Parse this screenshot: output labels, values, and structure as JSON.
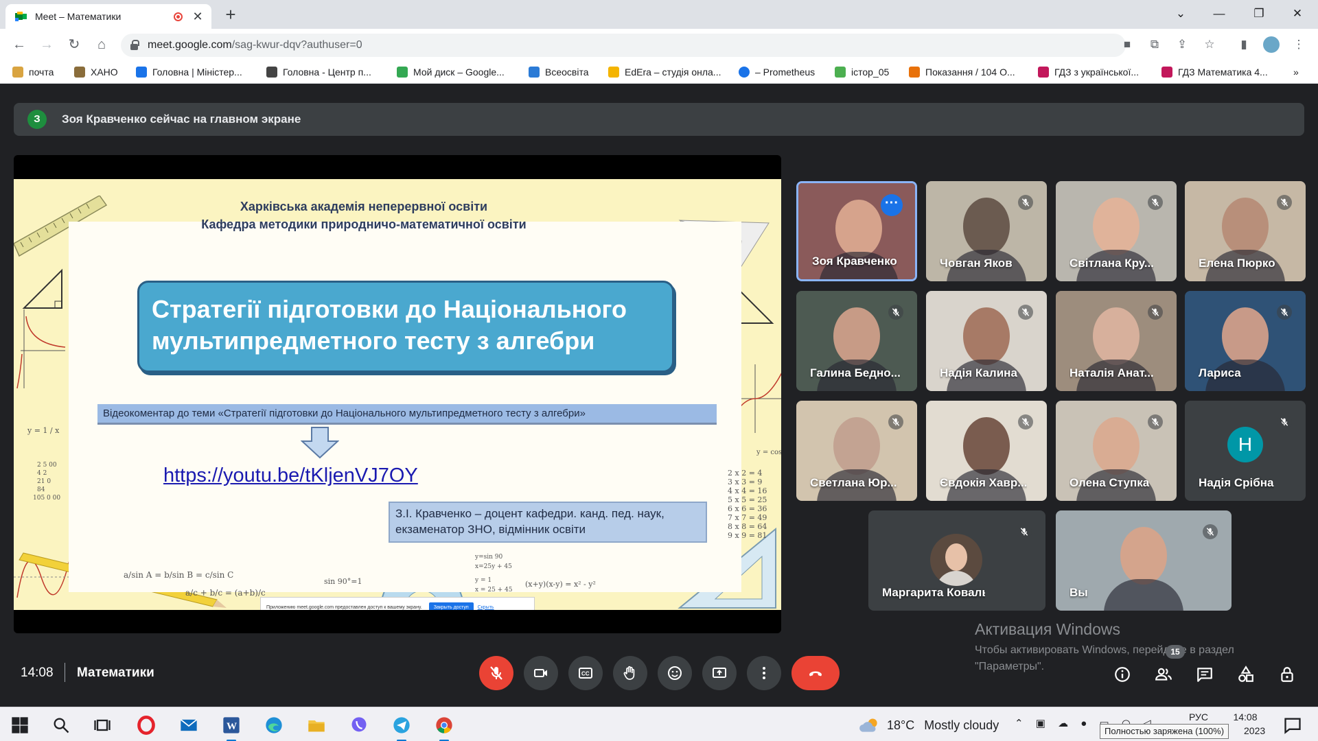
{
  "browser": {
    "tab_title": "Meet – Математики",
    "url_host": "meet.google.com",
    "url_path": "/sag-kwur-dqv?authuser=0",
    "new_tab_label": "+"
  },
  "bookmarks": [
    {
      "label": "почта",
      "icon_color": "#d9a441"
    },
    {
      "label": "ХАНО",
      "icon_color": "#8a6d3b"
    },
    {
      "label": "Головна | Міністер...",
      "icon_color": "#1a73e8"
    },
    {
      "label": "Головна - Центр п...",
      "icon_color": "#444444"
    },
    {
      "label": "Мой диск – Google...",
      "icon_color": "#34a853"
    },
    {
      "label": "Всеосвіта",
      "icon_color": "#2b7bd6"
    },
    {
      "label": "EdEra – студія онла...",
      "icon_color": "#f4b400"
    },
    {
      "label": "– Prometheus",
      "icon_color": "#1a73e8"
    },
    {
      "label": "істор_05",
      "icon_color": "#4caf50"
    },
    {
      "label": "Показання / 104 О...",
      "icon_color": "#e8710a"
    },
    {
      "label": "ГДЗ з української...",
      "icon_color": "#c2185b"
    },
    {
      "label": "ГДЗ Математика 4...",
      "icon_color": "#c2185b"
    }
  ],
  "bookmarks_overflow": "»",
  "banner": {
    "avatar_letter": "З",
    "text": "Зоя Кравченко сейчас на главном экране"
  },
  "slide": {
    "header_line1": "Харківська академія неперервної освіти",
    "header_line2": "Кафедра методики природничо-математичної освіти",
    "title_line1": "Стратегії підготовки до Національного",
    "title_line2": "мультипредметного тесту з алгебри",
    "comment": "Відеокоментар до теми «Стратегії підготовки до Національного мультипредметного тесту з алгебри»",
    "link": "https://youtu.be/tKljenVJ7OY",
    "author_line1": "З.І. Кравченко – доцент кафедри. канд. пед. наук,",
    "author_line2": "екзаменатор ЗНО, відмінник освіти",
    "share_notice": "Приложению meet.google.com предоставлен доступ к вашему экрану.",
    "share_stop": "Закрыть доступ",
    "share_hide": "Скрыть",
    "decor": {
      "y_eq": "y = 1 / x",
      "mult_a": "2 5 00",
      "mult_b": "4 2",
      "mult_c": "21 0",
      "mult_d": "84",
      "mult_e": "105 0 00",
      "sin_rule": "a/sin A = b/sin B = c/sin C",
      "sum_rule": "a/c + b/c = (a+b)/c",
      "sin90": "sin 90°=1",
      "system1": "y=sin 90",
      "system2": "x=25y + 45",
      "system3": "y = 1",
      "system4": "x = 25 + 45",
      "product": "(x+y)(x-y) = x² - y²",
      "table": [
        "2 x 2 = 4",
        "3 x 3 = 9",
        "4 x 4 = 16",
        "5 x 5 = 25",
        "6 x 6 = 36",
        "7 x 7 = 49",
        "8 x 8 = 64",
        "9 x 9 = 81"
      ],
      "y_cos": "y = cos"
    }
  },
  "participants": [
    {
      "name": "Зоя Кравченко",
      "muted": false,
      "more": true,
      "bg": "#8a5a5a",
      "face": "#d6a38c"
    },
    {
      "name": "Човган Яков",
      "muted": true,
      "bg": "#bdb6a7",
      "face": "#6b5b50"
    },
    {
      "name": "Світлана Кру...",
      "muted": true,
      "bg": "#b9b6ae",
      "face": "#e0b39a"
    },
    {
      "name": "Елена Пюрко",
      "muted": true,
      "bg": "#c6b8a5",
      "face": "#b88f7a"
    },
    {
      "name": "Галина Бедно...",
      "muted": true,
      "bg": "#4d5a52",
      "face": "#c79b86"
    },
    {
      "name": "Надія Калина",
      "muted": true,
      "bg": "#d9d4cc",
      "face": "#a77a66"
    },
    {
      "name": "Наталія Анат...",
      "muted": true,
      "bg": "#9d8d7d",
      "face": "#d7b09c"
    },
    {
      "name": "Лариса",
      "muted": true,
      "bg": "#2f5276",
      "face": "#c89a88"
    },
    {
      "name": "Светлана Юр...",
      "muted": true,
      "bg": "#d2c4ae",
      "face": "#c3a392"
    },
    {
      "name": "Євдокія Хавр...",
      "muted": true,
      "bg": "#e2dcd1",
      "face": "#7a5c4f"
    },
    {
      "name": "Олена Ступка",
      "muted": true,
      "bg": "#c9c2b6",
      "face": "#d9ac93"
    },
    {
      "name": "Надія Срібна",
      "muted": true,
      "letter": "Н"
    },
    {
      "name": "Маргарита Коваль",
      "muted": true,
      "avatar": true
    },
    {
      "name": "Вы",
      "muted": true,
      "bg": "#9fa9ae",
      "face": "#d4a48c"
    }
  ],
  "watermark": {
    "title": "Активация Windows",
    "line1": "Чтобы активировать Windows, перейдите в раздел",
    "line2": "\"Параметры\"."
  },
  "controls": {
    "time": "14:08",
    "meeting_name": "Математики",
    "people_count": "15"
  },
  "taskbar": {
    "temperature": "18°C",
    "weather": "Mostly cloudy",
    "lang": "РУС",
    "time": "14:08",
    "date_tail": "2023",
    "tooltip": "Полностью заряжена (100%)"
  },
  "colors": {
    "meet_bg": "#202124",
    "tile_bg": "#3c4043",
    "hangup": "#ea4335",
    "accent": "#1a73e8",
    "slide_title_bg": "#4aa8cf"
  }
}
